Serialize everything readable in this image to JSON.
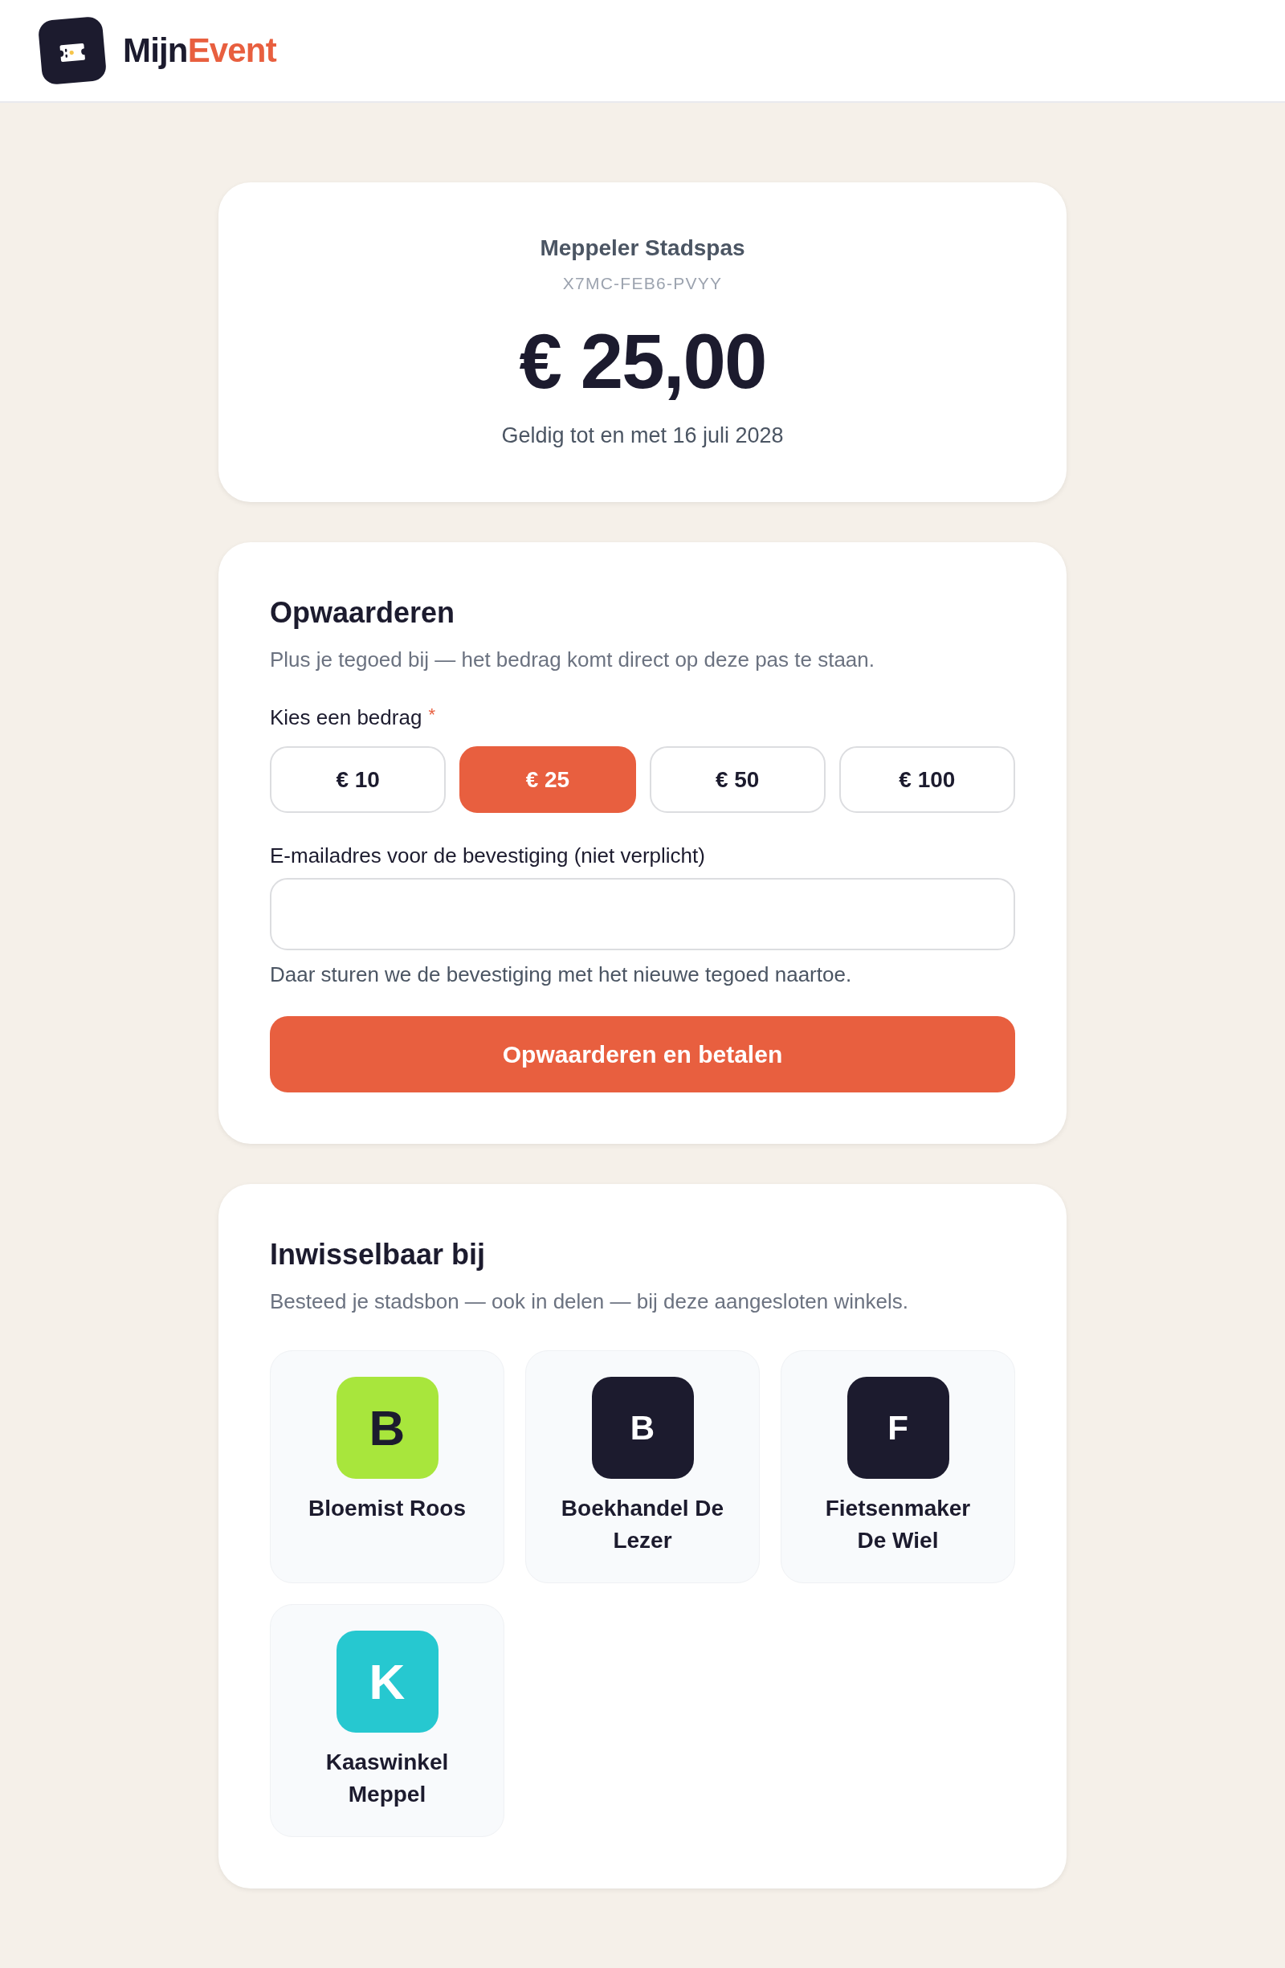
{
  "header": {
    "brand": [
      "Mijn",
      "Event"
    ]
  },
  "pass": {
    "name": "Meppeler Stadspas",
    "code": "X7MC-FEB6-PVYY",
    "balance": "€ 25,00",
    "validity": "Geldig tot en met 16 juli 2028"
  },
  "top_up": {
    "title": "Opwaarderen",
    "subtitle": "Plus je tegoed bij — het bedrag komt direct op deze pas te staan.",
    "amount_label": "Kies een bedrag",
    "required_mark": "*",
    "amounts": [
      {
        "label": "€ 10",
        "selected": false
      },
      {
        "label": "€ 25",
        "selected": true
      },
      {
        "label": "€ 50",
        "selected": false
      },
      {
        "label": "€ 100",
        "selected": false
      }
    ],
    "email": {
      "label": "E-mailadres voor de bevestiging (niet verplicht)",
      "help": "Daar sturen we de bevestiging met het nieuwe tegoed naartoe."
    },
    "submit": "Opwaarderen en betalen"
  },
  "shops": {
    "title": "Inwisselbaar bij",
    "subtitle": "Besteed je stadsbon — ook in delen — bij deze aangesloten winkels.",
    "items": [
      {
        "initial": "B",
        "name": "Bloemist Roos",
        "color": "#a8e63c",
        "kind": "brand"
      },
      {
        "initial": "B",
        "name": "Boekhandel De Lezer",
        "color": "#1c1b2e",
        "kind": "plain"
      },
      {
        "initial": "F",
        "name": "Fietsenmaker De Wiel",
        "color": "#1c1b2e",
        "kind": "plain"
      },
      {
        "initial": "K",
        "name": "Kaaswinkel Meppel",
        "color": "#26c8d0",
        "kind": "brand"
      }
    ]
  }
}
